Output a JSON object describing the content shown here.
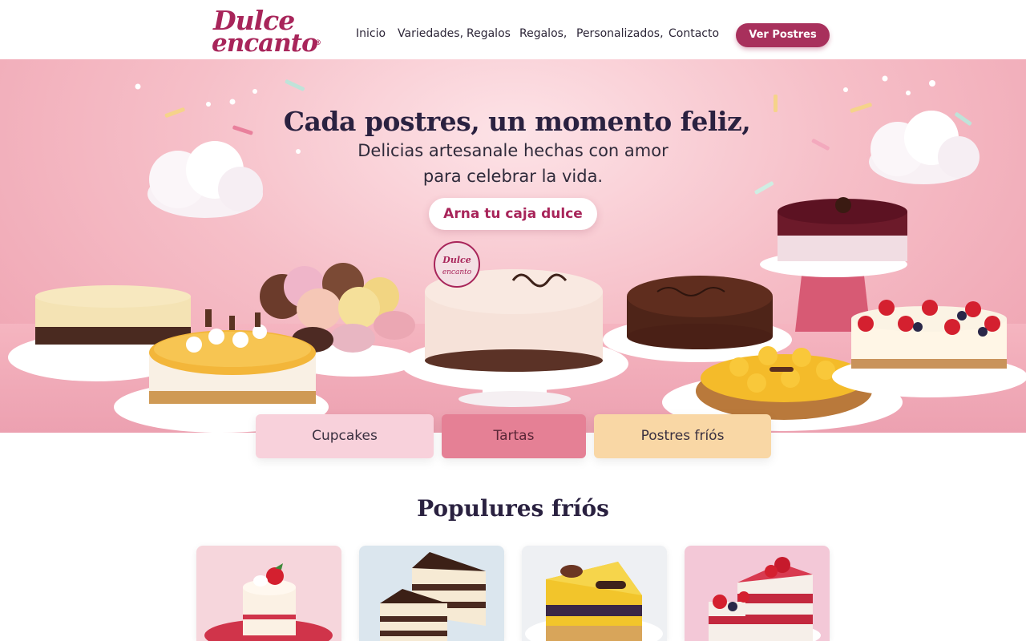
{
  "header": {
    "logo_line1": "Dulce",
    "logo_line2": "encanto",
    "logo_mark": "®",
    "nav": [
      {
        "label": "Inicio"
      },
      {
        "label": "Variedades,"
      },
      {
        "label": "Regalos"
      },
      {
        "label": "Regalos,"
      },
      {
        "label": "Personalizados,"
      },
      {
        "label": "Contacto"
      }
    ],
    "cta_label": "Ver Postres"
  },
  "hero": {
    "title": "Cada postres, un momento feliz,",
    "subtitle_line1": "Delicias artesanale hechas con amor",
    "subtitle_line2": "para celebrar la vida.",
    "button_label": "Arna tu caja dulce",
    "badge_text": "Dulce encanto"
  },
  "categories": [
    {
      "label": "Cupcakes",
      "color": "#f8d1db"
    },
    {
      "label": "Tartas",
      "color": "#e58095"
    },
    {
      "label": "Postres fríós",
      "color": "#f9d7a5"
    }
  ],
  "popular": {
    "title": "Populures fríós",
    "cards": [
      {
        "icon": "mini-cake-image"
      },
      {
        "icon": "chocolate-cake-slices-image"
      },
      {
        "icon": "mango-cake-slice-image"
      },
      {
        "icon": "berry-cake-image"
      }
    ]
  },
  "colors": {
    "brand": "#a8255a",
    "hero_pink": "#f6bfc8",
    "text_dark": "#2a2140"
  }
}
